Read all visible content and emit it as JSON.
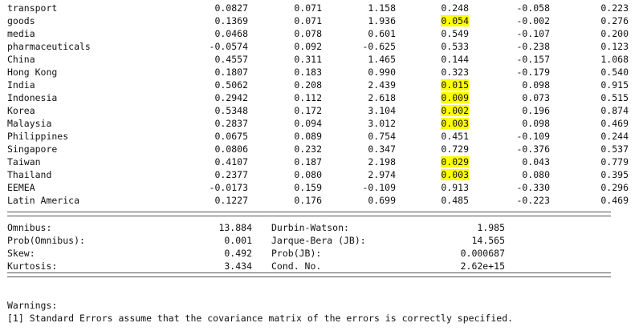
{
  "coefficients": [
    {
      "name": "transport",
      "coef": "0.0827",
      "std_err": "0.071",
      "z": "1.158",
      "p": "0.248",
      "ci_low": "-0.058",
      "ci_high": "0.223",
      "highlight": false
    },
    {
      "name": "goods",
      "coef": "0.1369",
      "std_err": "0.071",
      "z": "1.936",
      "p": "0.054",
      "ci_low": "-0.002",
      "ci_high": "0.276",
      "highlight": true
    },
    {
      "name": "media",
      "coef": "0.0468",
      "std_err": "0.078",
      "z": "0.601",
      "p": "0.549",
      "ci_low": "-0.107",
      "ci_high": "0.200",
      "highlight": false
    },
    {
      "name": "pharmaceuticals",
      "coef": "-0.0574",
      "std_err": "0.092",
      "z": "-0.625",
      "p": "0.533",
      "ci_low": "-0.238",
      "ci_high": "0.123",
      "highlight": false
    },
    {
      "name": "China",
      "coef": "0.4557",
      "std_err": "0.311",
      "z": "1.465",
      "p": "0.144",
      "ci_low": "-0.157",
      "ci_high": "1.068",
      "highlight": false
    },
    {
      "name": "Hong Kong",
      "coef": "0.1807",
      "std_err": "0.183",
      "z": "0.990",
      "p": "0.323",
      "ci_low": "-0.179",
      "ci_high": "0.540",
      "highlight": false
    },
    {
      "name": "India",
      "coef": "0.5062",
      "std_err": "0.208",
      "z": "2.439",
      "p": "0.015",
      "ci_low": "0.098",
      "ci_high": "0.915",
      "highlight": true
    },
    {
      "name": "Indonesia",
      "coef": "0.2942",
      "std_err": "0.112",
      "z": "2.618",
      "p": "0.009",
      "ci_low": "0.073",
      "ci_high": "0.515",
      "highlight": true
    },
    {
      "name": "Korea",
      "coef": "0.5348",
      "std_err": "0.172",
      "z": "3.104",
      "p": "0.002",
      "ci_low": "0.196",
      "ci_high": "0.874",
      "highlight": true
    },
    {
      "name": "Malaysia",
      "coef": "0.2837",
      "std_err": "0.094",
      "z": "3.012",
      "p": "0.003",
      "ci_low": "0.098",
      "ci_high": "0.469",
      "highlight": true
    },
    {
      "name": "Philippines",
      "coef": "0.0675",
      "std_err": "0.089",
      "z": "0.754",
      "p": "0.451",
      "ci_low": "-0.109",
      "ci_high": "0.244",
      "highlight": false
    },
    {
      "name": "Singapore",
      "coef": "0.0806",
      "std_err": "0.232",
      "z": "0.347",
      "p": "0.729",
      "ci_low": "-0.376",
      "ci_high": "0.537",
      "highlight": false
    },
    {
      "name": "Taiwan",
      "coef": "0.4107",
      "std_err": "0.187",
      "z": "2.198",
      "p": "0.029",
      "ci_low": "0.043",
      "ci_high": "0.779",
      "highlight": true
    },
    {
      "name": "Thailand",
      "coef": "0.2377",
      "std_err": "0.080",
      "z": "2.974",
      "p": "0.003",
      "ci_low": "0.080",
      "ci_high": "0.395",
      "highlight": true
    },
    {
      "name": "EEMEA",
      "coef": "-0.0173",
      "std_err": "0.159",
      "z": "-0.109",
      "p": "0.913",
      "ci_low": "-0.330",
      "ci_high": "0.296",
      "highlight": false
    },
    {
      "name": "Latin America",
      "coef": "0.1227",
      "std_err": "0.176",
      "z": "0.699",
      "p": "0.485",
      "ci_low": "-0.223",
      "ci_high": "0.469",
      "highlight": false
    }
  ],
  "diagnostics": [
    {
      "label1": "Omnibus:",
      "value1": "13.884",
      "label2": "Durbin-Watson:",
      "value2": "1.985"
    },
    {
      "label1": "Prob(Omnibus):",
      "value1": "0.001",
      "label2": "Jarque-Bera (JB):",
      "value2": "14.565"
    },
    {
      "label1": "Skew:",
      "value1": "0.492",
      "label2": "Prob(JB):",
      "value2": "0.000687"
    },
    {
      "label1": "Kurtosis:",
      "value1": "3.434",
      "label2": "Cond. No.",
      "value2": "2.62e+15"
    }
  ],
  "warnings": {
    "title": "Warnings:",
    "line1": "[1] Standard Errors assume that the covariance matrix of the errors is correctly specified."
  },
  "highlight_color": "#ffff00"
}
